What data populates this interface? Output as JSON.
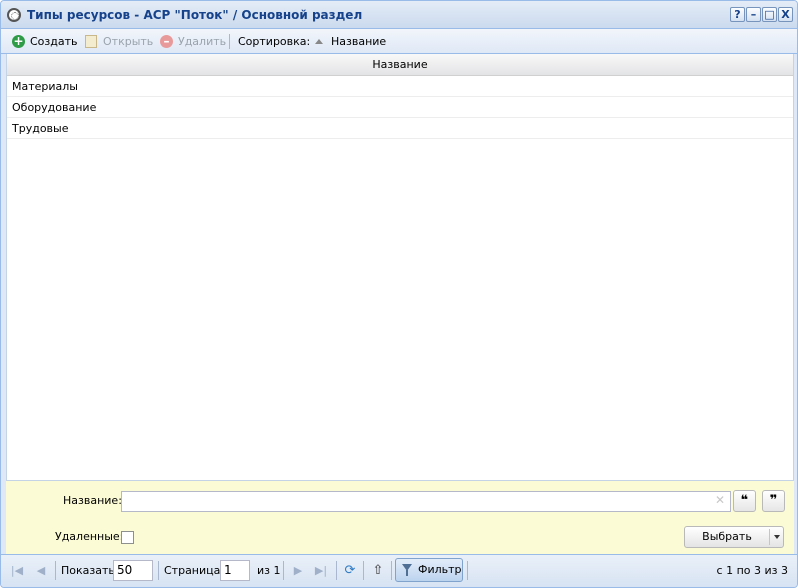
{
  "window": {
    "title": "Типы ресурсов - АСР \"Поток\" / Основной раздел",
    "tools": [
      "?",
      "–",
      "□",
      "X"
    ]
  },
  "toolbar": {
    "create_label": "Создать",
    "open_label": "Открыть",
    "delete_label": "Удалить",
    "sort_label": "Сортировка:",
    "sort_field": "Название"
  },
  "grid": {
    "column_header": "Название",
    "rows": [
      {
        "name": "Материалы"
      },
      {
        "name": "Оборудование"
      },
      {
        "name": "Трудовые"
      }
    ]
  },
  "filter": {
    "name_label": "Название:",
    "name_value": "",
    "clear_icon": "✕",
    "quote_open": "❝",
    "quote_close": "❞",
    "deleted_label": "Удаленные:",
    "deleted_checked": false,
    "select_label": "Выбрать"
  },
  "pager": {
    "show_label": "Показать",
    "page_size": "50",
    "page_label": "Страница",
    "page_value": "1",
    "of_label": "из 1",
    "filter_label": "Фильтр",
    "count_text": "с 1 по 3 из 3"
  },
  "colors": {
    "accent_title": "#15428b",
    "create_green": "#2e9b47",
    "delete_red": "#e26a6a",
    "filter_bg": "#fbfbd6"
  }
}
